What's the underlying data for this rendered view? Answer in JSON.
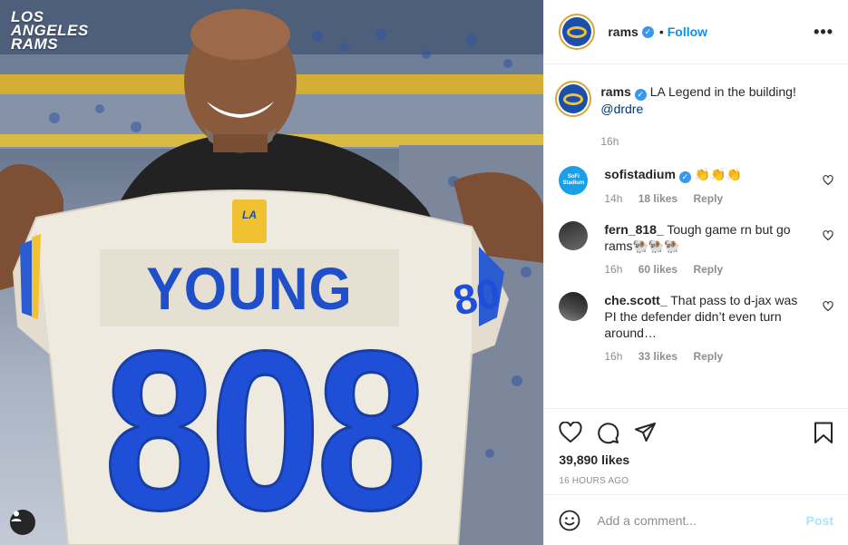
{
  "photo": {
    "logo_lines": [
      "LOS",
      "ANGELES",
      "RAMS"
    ],
    "jersey_name": "YOUNG",
    "jersey_number": "808",
    "sleeve_number": "80",
    "patch_text": "LA"
  },
  "header": {
    "username": "rams",
    "follow_label": "Follow",
    "more_label": "•••"
  },
  "caption": {
    "username": "rams",
    "text": "LA Legend in the building!",
    "mention": "@drdre",
    "time": "16h"
  },
  "comments": [
    {
      "username": "sofistadium",
      "avatar_text": "SoFi Stadium",
      "text": "👏👏👏",
      "time": "14h",
      "likes": "18 likes",
      "reply": "Reply"
    },
    {
      "username": "fern_818_",
      "text": "Tough game rn but go rams🐏🐏🐏",
      "time": "16h",
      "likes": "60 likes",
      "reply": "Reply"
    },
    {
      "username": "che.scott_",
      "text": "That pass to d-jax was PI the defender didn’t even turn around…",
      "time": "16h",
      "likes": "33 likes",
      "reply": "Reply"
    }
  ],
  "actions": {
    "likes": "39,890 likes",
    "time_ago": "16 HOURS AGO"
  },
  "add_comment": {
    "placeholder": "Add a comment...",
    "post_label": "Post"
  },
  "colors": {
    "rams_blue": "#1b4faa",
    "rams_gold": "#f2c230",
    "link_blue": "#0095f6"
  }
}
